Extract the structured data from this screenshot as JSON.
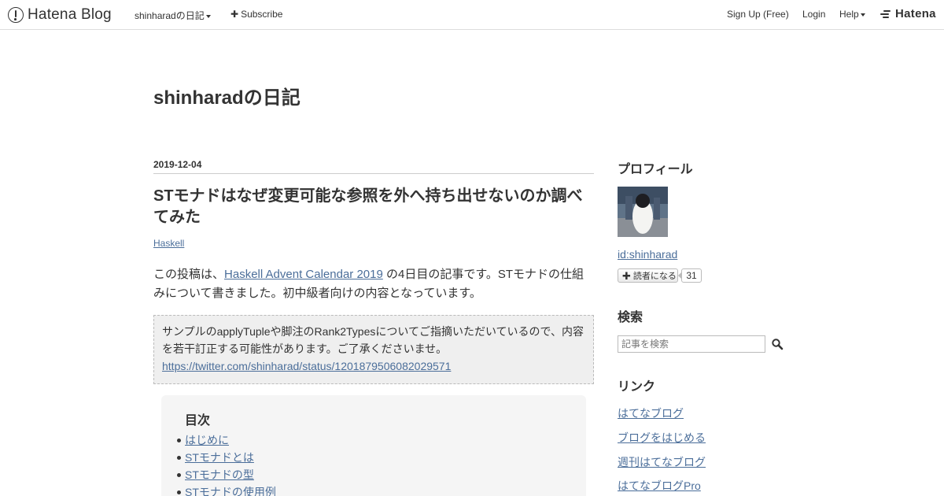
{
  "topbar": {
    "logo_text": "Hatena Blog",
    "blog_menu_label": "shinharadの日記",
    "subscribe_label": "Subscribe",
    "signup_label": "Sign Up (Free)",
    "login_label": "Login",
    "help_label": "Help",
    "hatena_logo_text": "Hatena"
  },
  "blog": {
    "title": "shinharadの日記"
  },
  "entry": {
    "date": "2019-12-04",
    "title": "STモナドはなぜ変更可能な参照を外へ持ち出せないのか調べてみた",
    "category": "Haskell",
    "intro_before": "この投稿は、",
    "intro_link": "Haskell Advent Calendar 2019",
    "intro_after": " の4日目の記事です。STモナドの仕組みについて書きました。初中級者向けの内容となっています。",
    "note_text": "サンプルのapplyTupleや脚注のRank2Typesについてご指摘いただいているので、内容を若干訂正する可能性があります。ご了承くださいませ。",
    "note_link": "https://twitter.com/shinharad/status/1201879506082029571",
    "toc_title": "目次",
    "toc_items": [
      "はじめに",
      "STモナドとは",
      "STモナドの型",
      "STモナドの使用例"
    ]
  },
  "sidebar": {
    "profile_heading": "プロフィール",
    "profile_id": "id:shinharad",
    "reader_button_label": "読者になる",
    "reader_count": "31",
    "search_heading": "検索",
    "search_placeholder": "記事を検索",
    "links_heading": "リンク",
    "links": [
      "はてなブログ",
      "ブログをはじめる",
      "週刊はてなブログ",
      "はてなブログPro"
    ]
  },
  "colors": {
    "link": "#4b6e9a",
    "text": "#333333",
    "note_background": "#efefef",
    "toc_background": "#f5f5f5"
  },
  "icons": [
    "hatena-blog-logo-icon",
    "chevron-down-icon",
    "plus-icon",
    "hatena-logo-icon",
    "search-icon"
  ]
}
